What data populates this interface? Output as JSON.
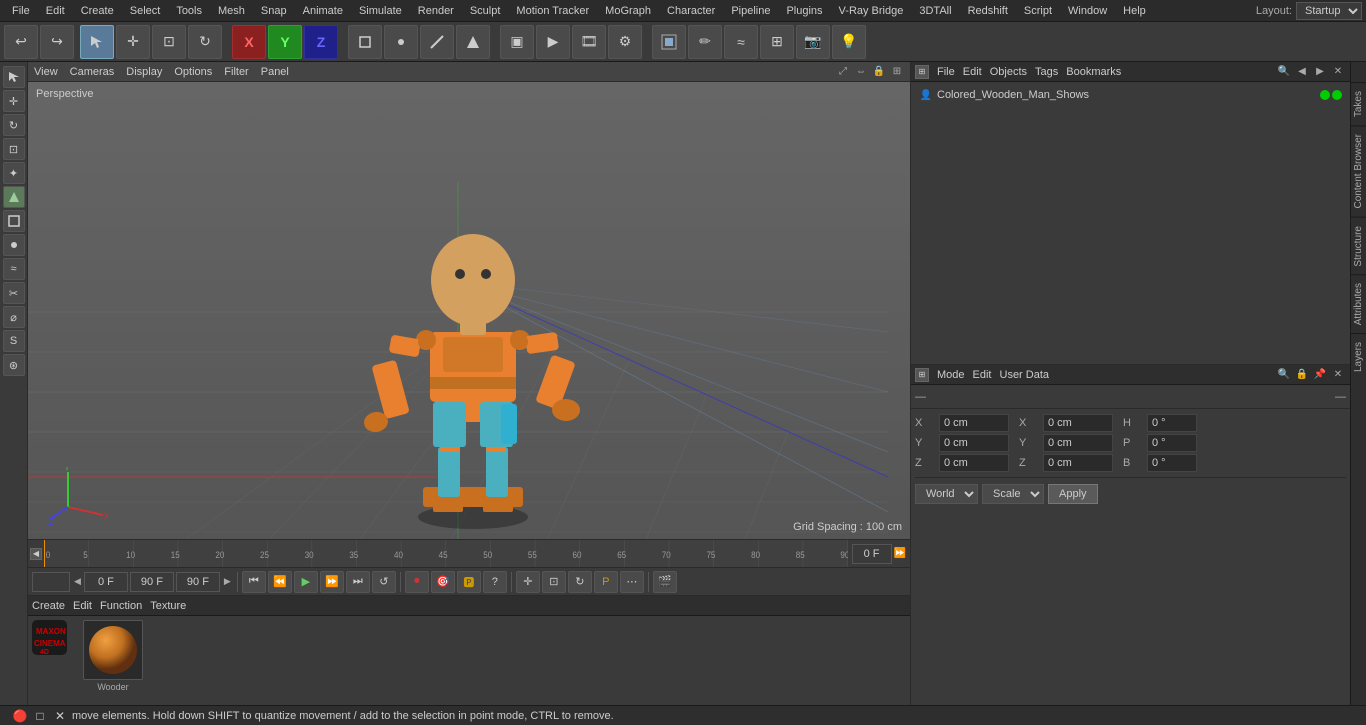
{
  "app": {
    "title": "Cinema 4D",
    "layout": "Startup"
  },
  "menu": {
    "items": [
      "File",
      "Edit",
      "Create",
      "Select",
      "Tools",
      "Mesh",
      "Snap",
      "Animate",
      "Simulate",
      "Render",
      "Sculpt",
      "Motion Tracker",
      "MoGraph",
      "Character",
      "Pipeline",
      "Plugins",
      "V-Ray Bridge",
      "3DTAll",
      "Redshift",
      "Script",
      "Window",
      "Help",
      "Layout:"
    ]
  },
  "toolbar": {
    "undo_label": "↩",
    "redo_label": "↪"
  },
  "viewport": {
    "perspective_label": "Perspective",
    "grid_spacing": "Grid Spacing : 100 cm",
    "header_items": [
      "View",
      "Cameras",
      "Display",
      "Options",
      "Filter",
      "Panel"
    ]
  },
  "timeline": {
    "marks": [
      0,
      5,
      10,
      15,
      20,
      25,
      30,
      35,
      40,
      45,
      50,
      55,
      60,
      65,
      70,
      75,
      80,
      85,
      90
    ],
    "current_frame": "0 F",
    "frame_input": "0 F",
    "start_frame": "0 F",
    "end_frame": "90 F",
    "end_frame2": "90 F"
  },
  "playback": {
    "frame_display": "0 F"
  },
  "object_manager": {
    "tabs": [
      "File",
      "Edit",
      "Objects",
      "Tags",
      "Bookmarks"
    ],
    "objects": [
      {
        "name": "Colored_Wooden_Man_Shows",
        "icon": "👤",
        "ind1_color": "#00cc00",
        "ind2_color": "#00cc00"
      }
    ]
  },
  "attribute_manager": {
    "tabs": [
      "Mode",
      "Edit",
      "User Data"
    ],
    "coord_labels": {
      "x": "X",
      "y": "Y",
      "z": "Z",
      "h": "H",
      "p": "P",
      "b": "B"
    },
    "coord_values": {
      "x_pos": "0 cm",
      "y_pos": "0 cm",
      "z_pos": "0 cm",
      "x_rot": "0 cm",
      "y_rot": "0 cm",
      "z_rot": "0 cm",
      "h_val": "0 °",
      "p_val": "0 °",
      "b_val": "0 °"
    },
    "world_label": "World",
    "scale_label": "Scale",
    "apply_label": "Apply"
  },
  "bottom_panel": {
    "tabs": [
      "Create",
      "Edit",
      "Function",
      "Texture"
    ],
    "material_name": "Wooder"
  },
  "status": {
    "text": "move elements. Hold down SHIFT to quantize movement / add to the selection in point mode, CTRL to remove."
  },
  "right_tabs": [
    "Takes",
    "Content Browser",
    "Structure",
    "Attributes",
    "Layers"
  ],
  "axes": {
    "x_color": "#cc3333",
    "y_color": "#33cc33",
    "z_color": "#3333cc"
  }
}
